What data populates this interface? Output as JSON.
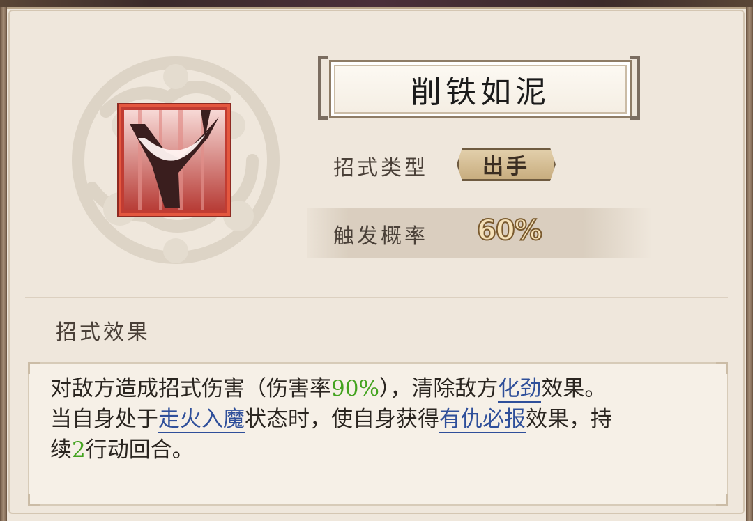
{
  "skill": {
    "name": "削铁如泥",
    "icon": "slash-skill-icon"
  },
  "attributes": {
    "type_label": "招式类型",
    "type_value": "出手",
    "chance_label": "触发概率",
    "chance_value": "60%"
  },
  "effect": {
    "heading": "招式效果",
    "line1_a": "对敌方造成招式伤害（伤害率",
    "line1_rate": "90%",
    "line1_b": "），清除敌方",
    "line1_link": "化劲",
    "line1_c": "效果。",
    "line2_a": "当自身处于",
    "line2_link1": "走火入魔",
    "line2_b": "状态时，使自身获得",
    "line2_link2": "有仇必报",
    "line2_c": "效果，持",
    "line3_a": "续",
    "line3_turns": "2",
    "line3_b": "行动回合。"
  },
  "colors": {
    "highlight_number": "#43a31f",
    "keyword_link": "#2f4f9a",
    "panel_bg": "#efe7dc"
  }
}
